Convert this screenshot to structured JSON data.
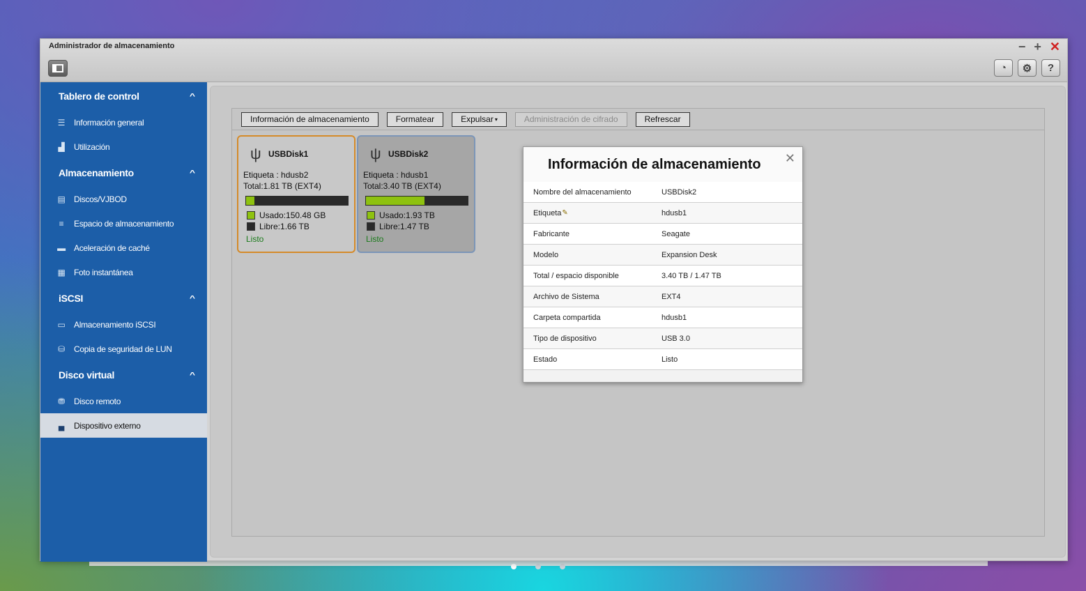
{
  "window": {
    "title": "Administrador de almacenamiento",
    "controls": {
      "minimize": "−",
      "maximize": "+",
      "close": "✕"
    },
    "tools": {
      "help": "?"
    }
  },
  "sidebar": {
    "sections": [
      {
        "title": "Tablero de control",
        "items": [
          {
            "label": "Información general",
            "icon": "list-icon"
          },
          {
            "label": "Utilización",
            "icon": "chart-icon"
          }
        ]
      },
      {
        "title": "Almacenamiento",
        "items": [
          {
            "label": "Discos/VJBOD",
            "icon": "disk-icon"
          },
          {
            "label": "Espacio de almacenamiento",
            "icon": "stack-icon"
          },
          {
            "label": "Aceleración de caché",
            "icon": "cache-icon"
          },
          {
            "label": "Foto instantánea",
            "icon": "snapshot-icon"
          }
        ]
      },
      {
        "title": "iSCSI",
        "items": [
          {
            "label": "Almacenamiento iSCSI",
            "icon": "iscsi-icon"
          },
          {
            "label": "Copia de seguridad de LUN",
            "icon": "backup-icon"
          }
        ]
      },
      {
        "title": "Disco virtual",
        "items": [
          {
            "label": "Disco remoto",
            "icon": "remote-disk-icon"
          },
          {
            "label": "Dispositivo externo",
            "icon": "external-device-icon",
            "active": true
          }
        ]
      }
    ]
  },
  "toolbar": {
    "info": "Información de almacenamiento",
    "format": "Formatear",
    "eject": "Expulsar",
    "encryption": "Administración de cifrado",
    "refresh": "Refrescar"
  },
  "disks": [
    {
      "name": "USBDisk1",
      "label": "Etiqueta : hdusb2",
      "total": "Total:1.81 TB (EXT4)",
      "used": "Usado:150.48 GB",
      "free": "Libre:1.66 TB",
      "used_fraction": 0.08,
      "status": "Listo"
    },
    {
      "name": "USBDisk2",
      "label": "Etiqueta : hdusb1",
      "total": "Total:3.40 TB (EXT4)",
      "used": "Usado:1.93 TB",
      "free": "Libre:1.47 TB",
      "used_fraction": 0.57,
      "status": "Listo"
    }
  ],
  "modal": {
    "title": "Información de almacenamiento",
    "rows": [
      {
        "key": "Nombre del almacenamiento",
        "value": "USBDisk2"
      },
      {
        "key": "Etiqueta",
        "value": "hdusb1"
      },
      {
        "key": "Fabricante",
        "value": "Seagate"
      },
      {
        "key": "Modelo",
        "value": "Expansion Desk"
      },
      {
        "key": "Total / espacio disponible",
        "value": "3.40 TB / 1.47 TB"
      },
      {
        "key": "Archivo de Sistema",
        "value": "EXT4"
      },
      {
        "key": "Carpeta compartida",
        "value": "hdusb1"
      },
      {
        "key": "Tipo de dispositivo",
        "value": "USB 3.0"
      },
      {
        "key": "Estado",
        "value": "Listo"
      }
    ]
  },
  "colors": {
    "sidebar": "#1c5ea8",
    "used": "#8ec210",
    "free": "#2a2a2a",
    "selected_border": "#d58a28",
    "status_ok": "#1a7a1a"
  }
}
